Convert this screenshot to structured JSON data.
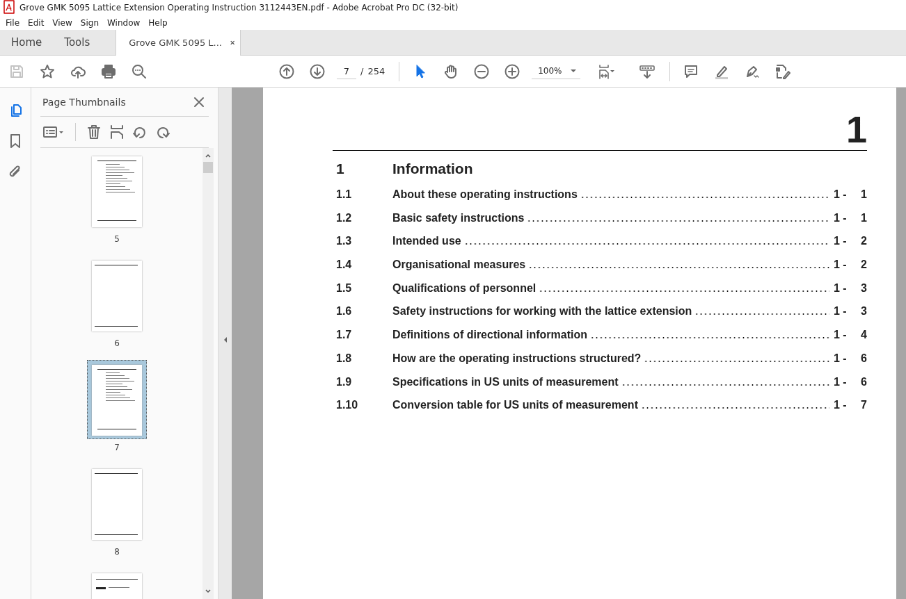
{
  "window": {
    "title": "Grove GMK 5095 Lattice Extension Operating Instruction  3112443EN.pdf - Adobe Acrobat Pro DC (32-bit)"
  },
  "menu": [
    "File",
    "Edit",
    "View",
    "Sign",
    "Window",
    "Help"
  ],
  "tabs": [
    {
      "label": "Home",
      "selected": false,
      "kind": "nav"
    },
    {
      "label": "Tools",
      "selected": false,
      "kind": "nav"
    },
    {
      "label": "Grove GMK 5095 L...",
      "selected": true,
      "kind": "document"
    }
  ],
  "toolbar": {
    "page": "7",
    "separator": "/",
    "total": "254",
    "zoom": "100%"
  },
  "panel": {
    "title": "Page Thumbnails",
    "thumbnails": [
      {
        "label": "5",
        "selected": false,
        "kind": "contents"
      },
      {
        "label": "6",
        "selected": false,
        "kind": "blank"
      },
      {
        "label": "7",
        "selected": true,
        "kind": "contents"
      },
      {
        "label": "8",
        "selected": false,
        "kind": "blank"
      },
      {
        "selected": false,
        "kind": "partial"
      }
    ]
  },
  "document": {
    "chapter": "1",
    "heading": {
      "number": "1",
      "title": "Information"
    },
    "entries": [
      {
        "number": "1.1",
        "title": "About these operating instructions",
        "prefix": "1 -",
        "page": "1"
      },
      {
        "number": "1.2",
        "title": "Basic safety instructions",
        "prefix": "1 -",
        "page": "1"
      },
      {
        "number": "1.3",
        "title": "Intended use",
        "prefix": "1 -",
        "page": "2"
      },
      {
        "number": "1.4",
        "title": "Organisational measures",
        "prefix": "1 -",
        "page": "2"
      },
      {
        "number": "1.5",
        "title": "Qualifications of personnel",
        "prefix": "1 -",
        "page": "3"
      },
      {
        "number": "1.6",
        "title": "Safety instructions for working with the lattice extension",
        "prefix": "1 -",
        "page": "3"
      },
      {
        "number": "1.7",
        "title": "Definitions of directional information",
        "prefix": "1 -",
        "page": "4"
      },
      {
        "number": "1.8",
        "title": "How are the operating instructions structured?",
        "prefix": "1 -",
        "page": "6"
      },
      {
        "number": "1.9",
        "title": "Specifications in US units of measurement",
        "prefix": "1 -",
        "page": "6"
      },
      {
        "number": "1.10",
        "title": "Conversion table for US units of measurement",
        "prefix": "1 -",
        "page": "7"
      }
    ]
  }
}
